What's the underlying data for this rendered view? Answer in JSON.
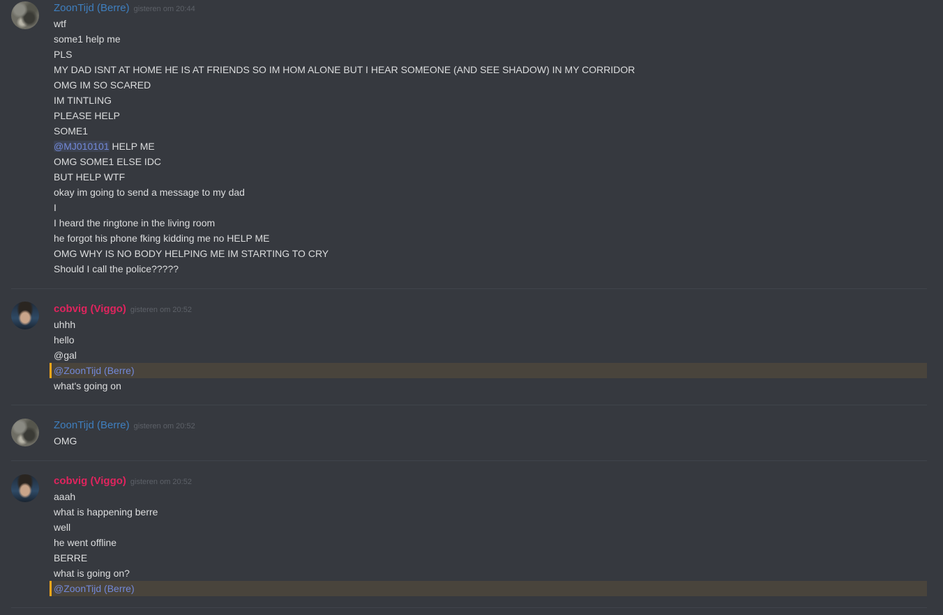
{
  "groups": [
    {
      "author": "ZoonTijd (Berre)",
      "timestamp": "gisteren om 20:44",
      "avatar_icon": "zoontijd-avatar",
      "name_color": "#3f7fbf",
      "messages": [
        {
          "text": "wtf"
        },
        {
          "text": "some1 help me"
        },
        {
          "text": "PLS"
        },
        {
          "text": "MY DAD ISNT AT HOME HE IS AT FRIENDS SO IM HOM ALONE BUT I HEAR SOMEONE (AND SEE SHADOW) IN MY CORRIDOR"
        },
        {
          "text": "OMG IM SO SCARED"
        },
        {
          "text": "IM TINTLING"
        },
        {
          "text": "PLEASE HELP"
        },
        {
          "text": "SOME1"
        },
        {
          "mention": "@MJ010101",
          "text": " HELP ME"
        },
        {
          "text": "OMG SOME1 ELSE IDC"
        },
        {
          "text": "BUT HELP WTF"
        },
        {
          "text": "okay im going to send a message to my dad"
        },
        {
          "text": "I"
        },
        {
          "text": "I heard the ringtone in the living room"
        },
        {
          "text": "he forgot his phone fking kidding me no HELP ME"
        },
        {
          "text": "OMG WHY IS NO BODY HELPING ME IM STARTING TO CRY"
        },
        {
          "text": "Should I call the police?????"
        }
      ]
    },
    {
      "author": "cobvig (Viggo)",
      "timestamp": "gisteren om 20:52",
      "avatar_icon": "cobvig-avatar",
      "name_color": "#e0245e",
      "messages": [
        {
          "text": "uhhh"
        },
        {
          "text": "hello"
        },
        {
          "text": "@gal"
        },
        {
          "text": "@ZoonTijd (Berre)",
          "highlight": true
        },
        {
          "text": "what's going on"
        }
      ]
    },
    {
      "author": "ZoonTijd (Berre)",
      "timestamp": "gisteren om 20:52",
      "avatar_icon": "zoontijd-avatar",
      "name_color": "#3f7fbf",
      "messages": [
        {
          "text": "OMG"
        }
      ]
    },
    {
      "author": "cobvig (Viggo)",
      "timestamp": "gisteren om 20:52",
      "avatar_icon": "cobvig-avatar",
      "name_color": "#e0245e",
      "messages": [
        {
          "text": "aaah"
        },
        {
          "text": "what is happening berre"
        },
        {
          "text": "well"
        },
        {
          "text": "he went offline"
        },
        {
          "text": "BERRE"
        },
        {
          "text": "what is going on?"
        },
        {
          "text": "@ZoonTijd (Berre)",
          "highlight": true
        }
      ]
    }
  ],
  "colors": {
    "background": "#36393f",
    "text": "#dcddde",
    "timestamp": "#5d6168",
    "mention": "#7289da",
    "mention_highlight_bar": "#faa61a",
    "mention_highlight_bg": "#49443c"
  }
}
